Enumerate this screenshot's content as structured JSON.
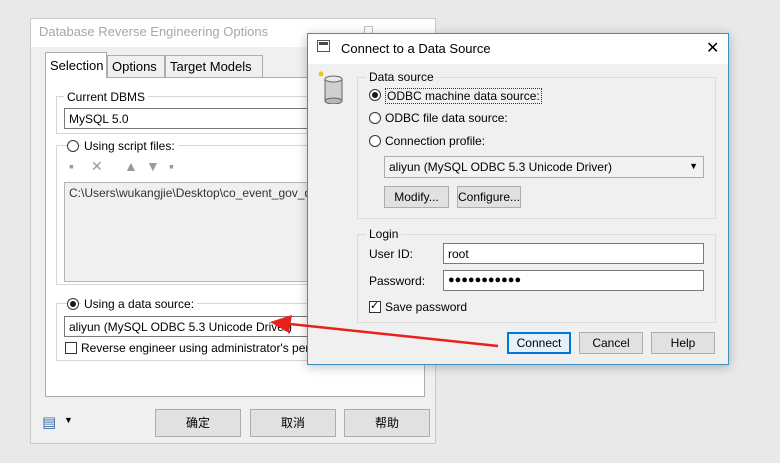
{
  "back_window": {
    "title": "Database Reverse Engineering Options",
    "tabs": [
      "Selection",
      "Options",
      "Target Models"
    ],
    "current_dbms_label": "Current DBMS",
    "current_dbms_value": "MySQL 5.0",
    "script_files_label": "Using script files:",
    "script_file_path": "C:\\Users\\wukangjie\\Desktop\\co_event_gov_dep",
    "data_source_label": "Using a data source:",
    "data_source_value": "aliyun (MySQL ODBC 5.3 Unicode Driver)",
    "admin_check_label": "Reverse engineer using administrator's permissio",
    "buttons": {
      "ok": "确定",
      "cancel": "取消",
      "help": "帮助"
    }
  },
  "dialog": {
    "title": "Connect to a Data Source",
    "data_source_group": "Data source",
    "radio_machine": "ODBC machine data source:",
    "radio_file": "ODBC file data source:",
    "radio_profile": "Connection profile:",
    "selected_source": "aliyun (MySQL ODBC 5.3 Unicode Driver)",
    "modify_button": "Modify...",
    "configure_button": "Configure...",
    "login_group": "Login",
    "user_id_label": "User ID:",
    "user_id_value": "root",
    "password_label": "Password:",
    "password_value": "●●●●●●●●●●●",
    "save_password_label": "Save password",
    "buttons": {
      "connect": "Connect",
      "cancel": "Cancel",
      "help": "Help"
    }
  },
  "colors": {
    "arrow": "#e8221b",
    "accent": "#0078d7"
  }
}
